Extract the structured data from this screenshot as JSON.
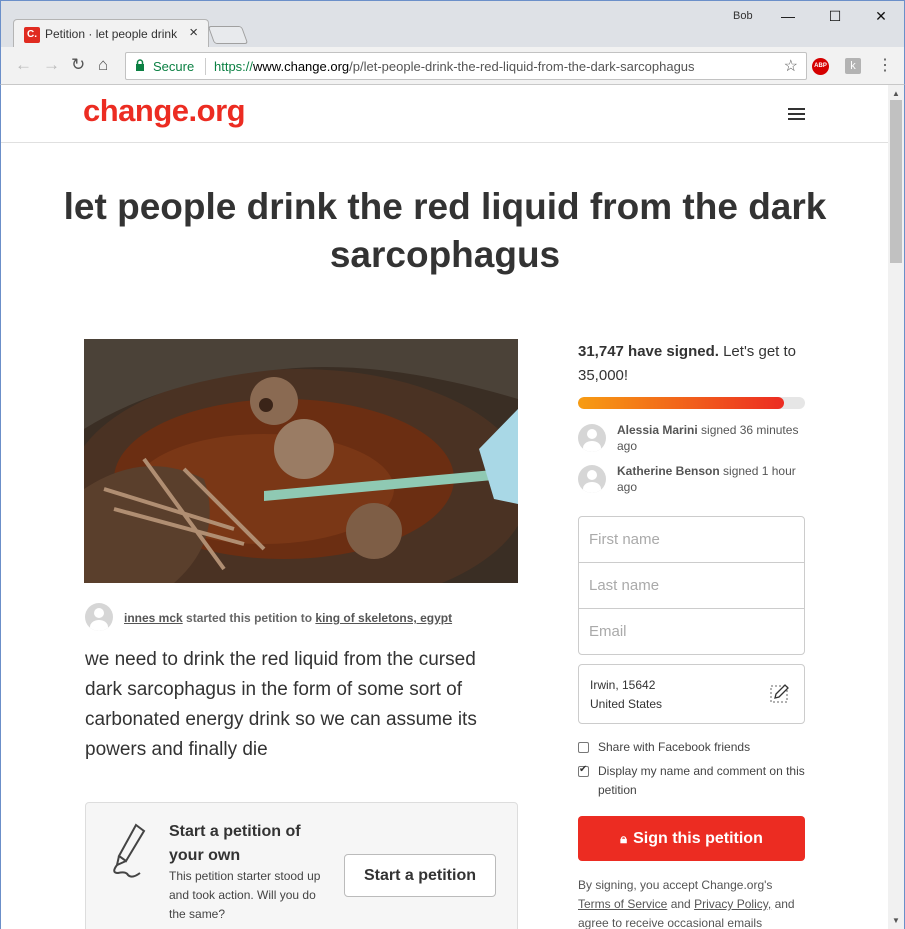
{
  "browser": {
    "tab_title": "Petition · let people drink the red liquid",
    "tab_favicon": "C.",
    "profile_name": "Bob",
    "secure_label": "Secure",
    "url_scheme": "https://",
    "url_host": "www.change.org",
    "url_path": "/p/let-people-drink-the-red-liquid-from-the-dark-sarcophagus",
    "extension_abp": "ABP",
    "extension_k": "k"
  },
  "site": {
    "logo": "change.org"
  },
  "petition": {
    "title": "let people drink the red liquid from the dark sarcophagus",
    "starter_name": "innes mck",
    "starter_mid": "started this petition to",
    "target": "king of skeletons, egypt",
    "body": "we need to drink the red liquid from the cursed dark sarcophagus in the form of some sort of carbonated energy drink so we can assume its powers and finally die"
  },
  "start_box": {
    "title": "Start a petition of your own",
    "text": "This petition starter stood up and took action. Will you do the same?",
    "button": "Start a petition"
  },
  "sidebar": {
    "signed_count": "31,747 have signed.",
    "goal_text": "Let's get to 35,000!",
    "progress_fraction": 0.907,
    "signers": [
      {
        "name": "Alessia Marini",
        "text": "signed 36 minutes ago"
      },
      {
        "name": "Katherine Benson",
        "text": "signed 1 hour ago"
      }
    ],
    "form": {
      "first_name_placeholder": "First name",
      "last_name_placeholder": "Last name",
      "email_placeholder": "Email",
      "location_line1": "Irwin, 15642",
      "location_line2": "United States"
    },
    "share_facebook": "Share with Facebook friends",
    "display_name": "Display my name and comment on this petition",
    "sign_button": "Sign this petition",
    "legal_prefix": "By signing, you accept Change.org's",
    "legal_tos": "Terms of Service",
    "legal_and": "and",
    "legal_privacy": "Privacy Policy,",
    "legal_suffix": "and agree to receive occasional emails"
  },
  "colors": {
    "brand_red": "#ec2c22",
    "progress_start": "#f79c13"
  }
}
